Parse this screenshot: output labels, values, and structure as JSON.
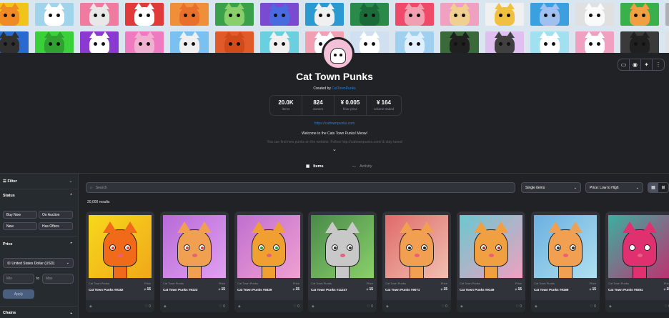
{
  "banner": {
    "row1": [
      {
        "bg": "#f0c419",
        "cat": "#f08a24"
      },
      {
        "bg": "#9fd4ea",
        "cat": "#ffffff"
      },
      {
        "bg": "#f07aa0",
        "cat": "#e8e8e8"
      },
      {
        "bg": "#e03a3a",
        "cat": "#ffffff"
      },
      {
        "bg": "#f08f3a",
        "cat": "#e8702a"
      },
      {
        "bg": "#3aa04a",
        "cat": "#8ad06a"
      },
      {
        "bg": "#7a4ad0",
        "cat": "#4a6ae0"
      },
      {
        "bg": "#2a9ad0",
        "cat": "#f0f0f0"
      },
      {
        "bg": "#2a8a4a",
        "cat": "#1a6a3a"
      },
      {
        "bg": "#f04a6a",
        "cat": "#f0a0b0"
      },
      {
        "bg": "#f0a0c0",
        "cat": "#f0d090"
      },
      {
        "bg": "#f0f0f0",
        "cat": "#f0c040"
      },
      {
        "bg": "#3aa0e0",
        "cat": "#a0c0f0"
      },
      {
        "bg": "#e0e0e0",
        "cat": "#fafafa"
      },
      {
        "bg": "#3ab04a",
        "cat": "#f0a040"
      },
      {
        "bg": "#b0b0b0",
        "cat": "#e0e0e0"
      }
    ],
    "row2": [
      {
        "bg": "#2a6ad0",
        "cat": "#303030"
      },
      {
        "bg": "#3ad03a",
        "cat": "#30a030"
      },
      {
        "bg": "#8a3ad0",
        "cat": "#ffffff"
      },
      {
        "bg": "#f07ac0",
        "cat": "#f0b0d0"
      },
      {
        "bg": "#7ac0f0",
        "cat": "#f0f0f0"
      },
      {
        "bg": "#e05a2a",
        "cat": "#d04a1a"
      },
      {
        "bg": "#6ad0e0",
        "cat": "#f0f0f0"
      },
      {
        "bg": "#f0a0b0",
        "cat": "#ffffff"
      },
      {
        "bg": "#d0e0f0",
        "cat": "#ffffff"
      },
      {
        "bg": "#a0d0f0",
        "cat": "#e0f0ff"
      },
      {
        "bg": "#3a6a3a",
        "cat": "#202020"
      },
      {
        "bg": "#e0c0f0",
        "cat": "#404040"
      },
      {
        "bg": "#a0e0f0",
        "cat": "#ffffff"
      },
      {
        "bg": "#f0a0c0",
        "cat": "#ffffff"
      },
      {
        "bg": "#3a3a3a",
        "cat": "#202020"
      },
      {
        "bg": "#e0e0e0",
        "cat": "#ffffff"
      }
    ]
  },
  "header": {
    "title": "Cat Town Punks",
    "created_by_label": "Created by",
    "creator": "CatTownPunks",
    "stats": [
      {
        "value": "20.0K",
        "label": "items"
      },
      {
        "value": "824",
        "label": "owners"
      },
      {
        "value": "¥ 0.005",
        "label": "floor price"
      },
      {
        "value": "¥ 164",
        "label": "volume traded"
      }
    ],
    "link": "https://cattownpunks.com",
    "description": "Welcome to the Cats Town Punks! Meow!",
    "description_more": "You can find new punks on the website. Follow http://cattownpunks.com/ & stay tuned"
  },
  "social_icons": [
    "web-icon",
    "discord-icon",
    "twitter-icon",
    "more-icon"
  ],
  "tabs": [
    {
      "label": "Items",
      "icon": "grid-icon",
      "active": true
    },
    {
      "label": "Activity",
      "icon": "activity-icon",
      "active": false
    }
  ],
  "sidebar": {
    "filter_label": "Filter",
    "status_label": "Status",
    "status_buttons": [
      "Buy Now",
      "On Auction",
      "New",
      "Has Offers"
    ],
    "price_label": "Price",
    "currency": "United States Dollar (USD)",
    "min_placeholder": "Min",
    "to_label": "to",
    "max_placeholder": "Max",
    "apply_label": "Apply",
    "chains_label": "Chains"
  },
  "toolbar": {
    "search_placeholder": "Search",
    "items_filter": "Single items",
    "sort": "Price: Low to High"
  },
  "results_count": "20,000 results",
  "cards": [
    {
      "collection": "Cat Town Punks",
      "name": "Cat Town Punks #9182",
      "price_label": "Price",
      "price": "15",
      "likes": "0",
      "bg": "#f7d81c",
      "bg2": "#f0a81a",
      "cat": "#f06a1a",
      "eye": "#e8402a"
    },
    {
      "collection": "Cat Town Punks",
      "name": "Cat Town Punks #9123",
      "price_label": "Price",
      "price": "15",
      "likes": "0",
      "bg": "#b86ad8",
      "bg2": "#e0a0f0",
      "cat": "#f0a050",
      "eye": "#d04040"
    },
    {
      "collection": "Cat Town Punks",
      "name": "Cat Town Punks #9329",
      "price_label": "Price",
      "price": "15",
      "likes": "0",
      "bg": "#c070d0",
      "bg2": "#f0a0d0",
      "cat": "#f0a030",
      "eye": "#30a030"
    },
    {
      "collection": "Cat Town Punks",
      "name": "Cat Town Punks #11247",
      "price_label": "Price",
      "price": "15",
      "likes": "0",
      "bg": "#4a8a4a",
      "bg2": "#8ad06a",
      "cat": "#c8c8c8",
      "eye": "#303030"
    },
    {
      "collection": "Cat Town Punks",
      "name": "Cat Town Punks #9071",
      "price_label": "Price",
      "price": "15",
      "likes": "0",
      "bg": "#e06a6a",
      "bg2": "#f0c0b0",
      "cat": "#f0a050",
      "eye": "#202020"
    },
    {
      "collection": "Cat Town Punks",
      "name": "Cat Town Punks #9149",
      "price_label": "Price",
      "price": "15",
      "likes": "0",
      "bg": "#6ac8d0",
      "bg2": "#f0a0c0",
      "cat": "#f0a040",
      "eye": "#a03030"
    },
    {
      "collection": "Cat Town Punks",
      "name": "Cat Town Punks #9189",
      "price_label": "Price",
      "price": "15",
      "likes": "0",
      "bg": "#6ab0e0",
      "bg2": "#b0e0f0",
      "cat": "#f0a050",
      "eye": "#303030"
    },
    {
      "collection": "Cat Town Punks",
      "name": "Cat Town Punks #9281",
      "price_label": "Price",
      "price": "15",
      "likes": "0",
      "bg": "#3ab0a0",
      "bg2": "#c03070",
      "cat": "#e03070",
      "eye": "#ffffff"
    }
  ]
}
